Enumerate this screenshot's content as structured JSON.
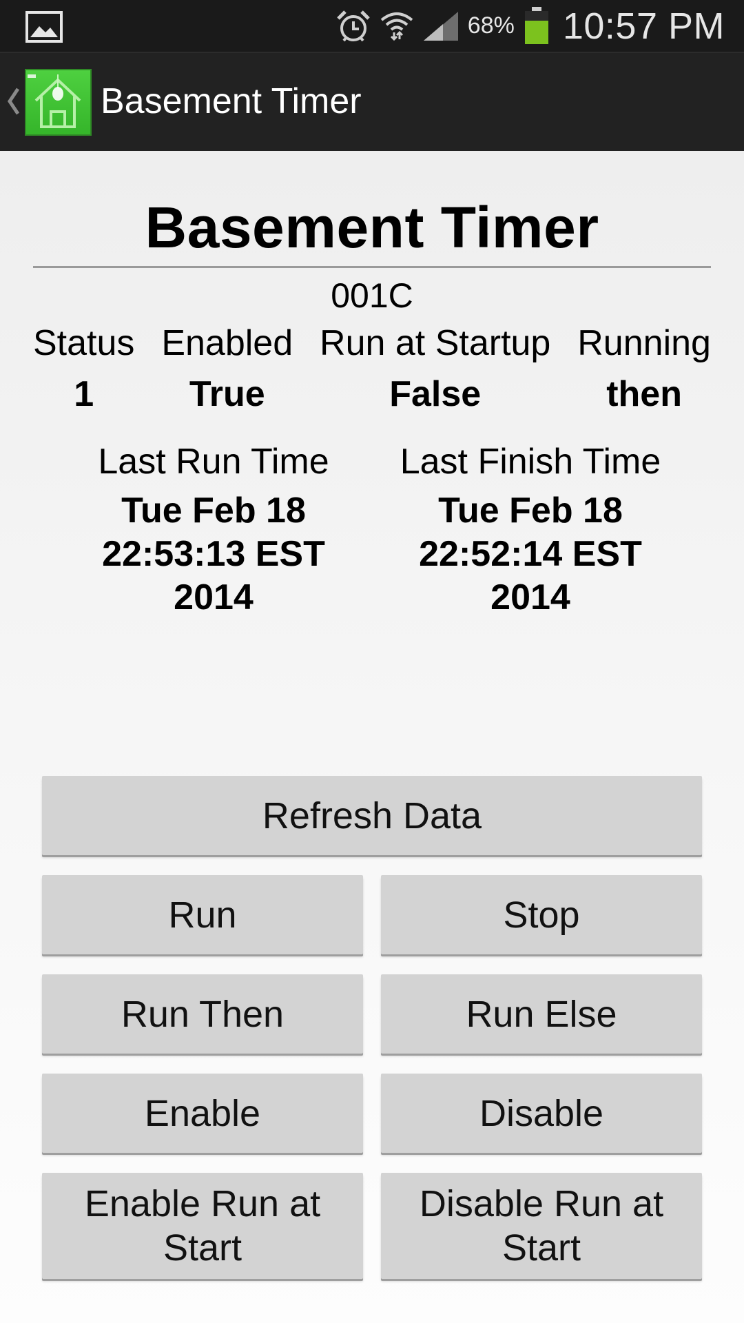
{
  "status_bar": {
    "battery_percent": "68%",
    "time": "10:57 PM",
    "icons": [
      "gallery-icon",
      "alarm-icon",
      "wifi-icon",
      "signal-icon",
      "battery-icon"
    ]
  },
  "action_bar": {
    "title": "Basement Timer",
    "logo_icon": "house-lightbulb-icon"
  },
  "main": {
    "title": "Basement Timer",
    "device_id": "001C",
    "stats": [
      {
        "label": "Status",
        "value": "1"
      },
      {
        "label": "Enabled",
        "value": "True"
      },
      {
        "label": "Run at Startup",
        "value": "False"
      },
      {
        "label": "Running",
        "value": "then"
      }
    ],
    "last_run": {
      "label": "Last Run Time",
      "value": "Tue Feb 18\n22:53:13 EST\n2014"
    },
    "last_finish": {
      "label": "Last Finish Time",
      "value": "Tue Feb 18\n22:52:14 EST\n2014"
    }
  },
  "buttons": {
    "refresh": "Refresh Data",
    "run": "Run",
    "stop": "Stop",
    "run_then": "Run Then",
    "run_else": "Run Else",
    "enable": "Enable",
    "disable": "Disable",
    "enable_run_at_start": "Enable Run at\nStart",
    "disable_run_at_start": "Disable Run at\nStart"
  },
  "colors": {
    "status_bar_bg": "#1a1a1a",
    "action_bar_bg": "#222222",
    "logo_green": "#4ed040",
    "button_bg": "#d3d3d3",
    "battery_green": "#7cc21e"
  }
}
